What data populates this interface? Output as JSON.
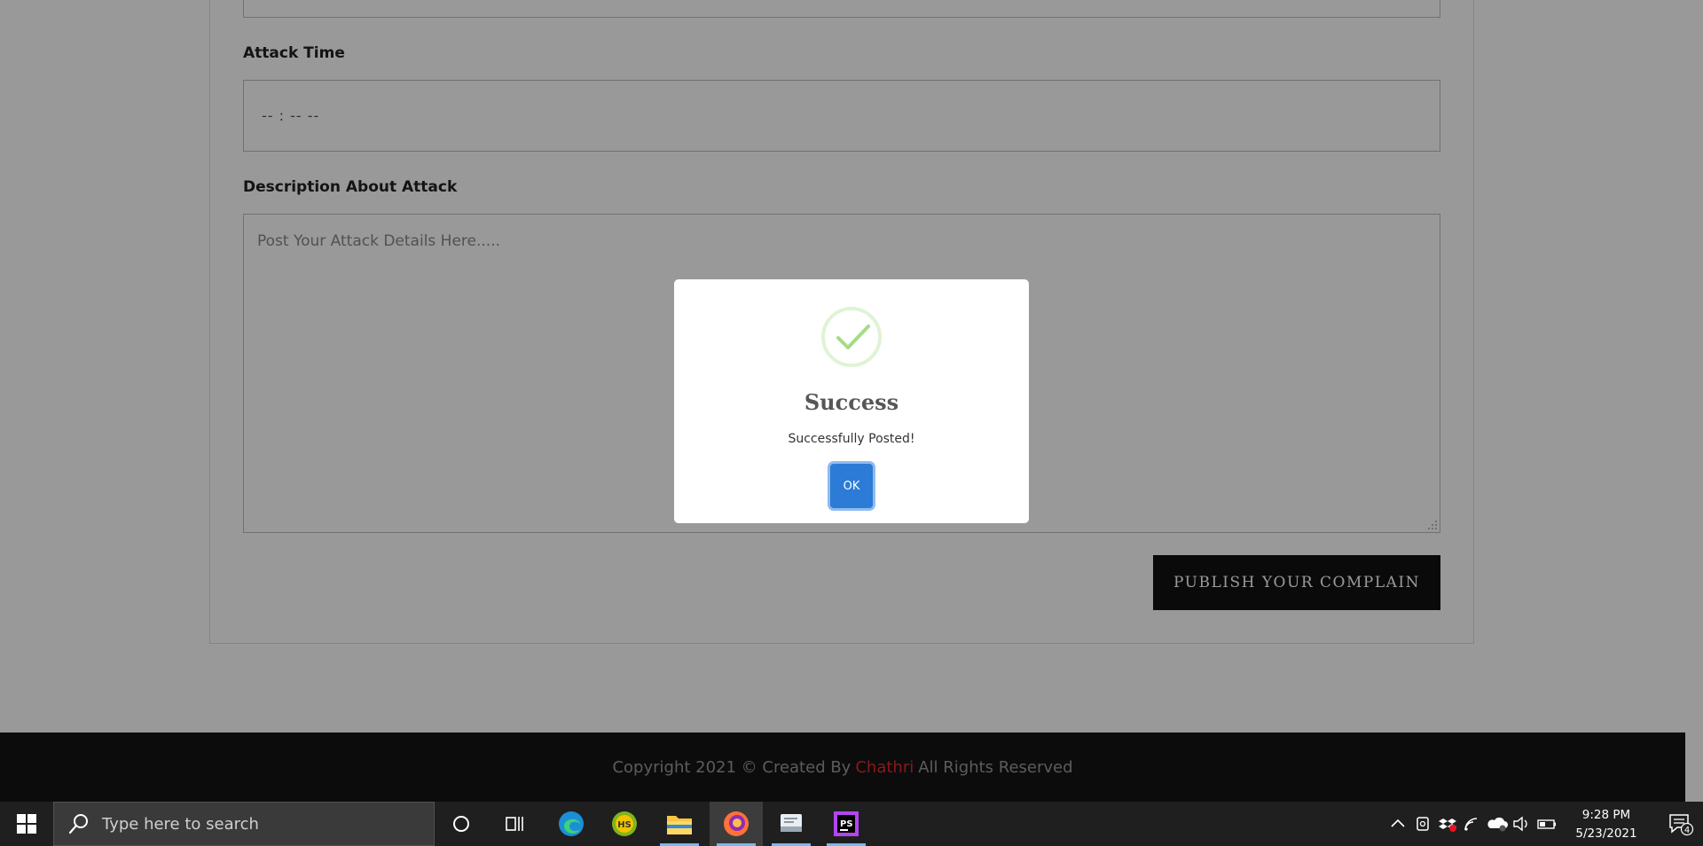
{
  "form": {
    "attack_time_label": "Attack Time",
    "attack_time_value": "-- : --  --",
    "description_label": "Description About Attack",
    "description_placeholder": "Post Your Attack Details Here.....",
    "publish_button": "PUBLISH YOUR COMPLAIN"
  },
  "footer": {
    "prefix": "Copyright 2021 © Created By",
    "brand": "Chathri",
    "suffix": "All Rights Reserved",
    "brand_color": "#e52a2a"
  },
  "modal": {
    "icon": "success-check-icon",
    "title": "Success",
    "message": "Successfully Posted!",
    "ok_label": "OK",
    "accent_color": "#2c7bd6"
  },
  "taskbar": {
    "search_placeholder": "Type here to search",
    "apps": [
      "cortana",
      "task-view",
      "edge",
      "hs-app",
      "file-explorer",
      "firefox",
      "mail-app",
      "phpstorm"
    ],
    "time": "9:28 PM",
    "date": "5/23/2021",
    "notification_count": "4"
  }
}
